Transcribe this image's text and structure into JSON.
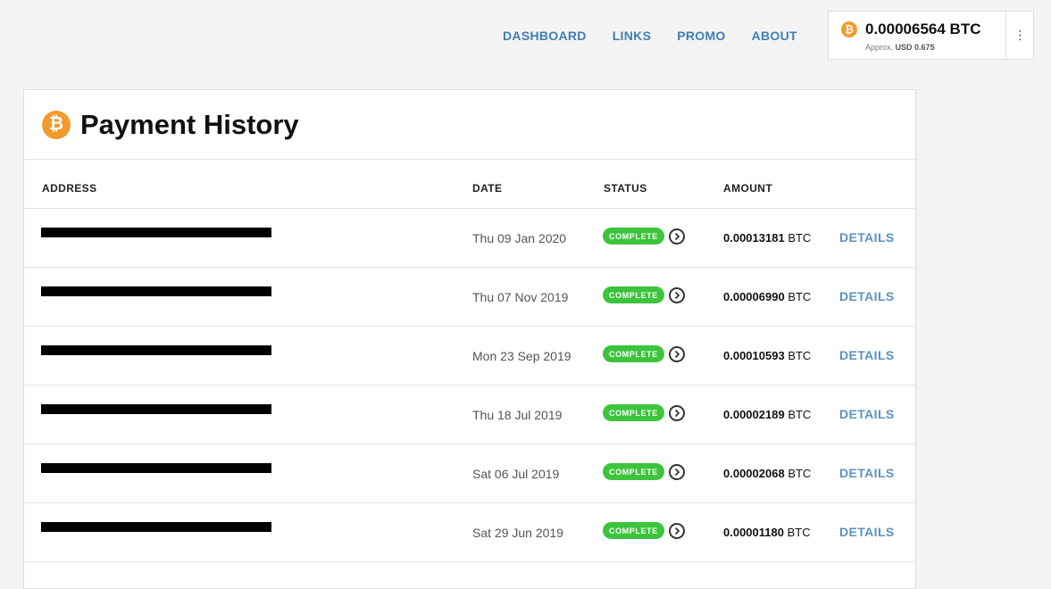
{
  "nav": {
    "items": [
      {
        "label": "DASHBOARD"
      },
      {
        "label": "LINKS"
      },
      {
        "label": "PROMO"
      },
      {
        "label": "ABOUT"
      }
    ]
  },
  "balance": {
    "amount": "0.00006564 BTC",
    "approx_label": "Approx.",
    "approx_value": "USD 0.675",
    "coin_glyph": "₿",
    "menu_glyph": "⋮"
  },
  "page": {
    "title": "Payment History",
    "coin_glyph": "₿"
  },
  "table": {
    "headers": {
      "address": "ADDRESS",
      "date": "DATE",
      "status": "STATUS",
      "amount": "AMOUNT"
    },
    "rows": [
      {
        "date": "Thu 09 Jan 2020",
        "status": "COMPLETE",
        "amount": "0.00013181",
        "unit": "BTC",
        "details": "DETAILS"
      },
      {
        "date": "Thu 07 Nov 2019",
        "status": "COMPLETE",
        "amount": "0.00006990",
        "unit": "BTC",
        "details": "DETAILS"
      },
      {
        "date": "Mon 23 Sep 2019",
        "status": "COMPLETE",
        "amount": "0.00010593",
        "unit": "BTC",
        "details": "DETAILS"
      },
      {
        "date": "Thu 18 Jul 2019",
        "status": "COMPLETE",
        "amount": "0.00002189",
        "unit": "BTC",
        "details": "DETAILS"
      },
      {
        "date": "Sat 06 Jul 2019",
        "status": "COMPLETE",
        "amount": "0.00002068",
        "unit": "BTC",
        "details": "DETAILS"
      },
      {
        "date": "Sat 29 Jun 2019",
        "status": "COMPLETE",
        "amount": "0.00001180",
        "unit": "BTC",
        "details": "DETAILS"
      }
    ]
  },
  "colors": {
    "accent_link": "#3f7fb5",
    "bitcoin_orange": "#f29a2e",
    "status_green": "#3cc43c"
  }
}
